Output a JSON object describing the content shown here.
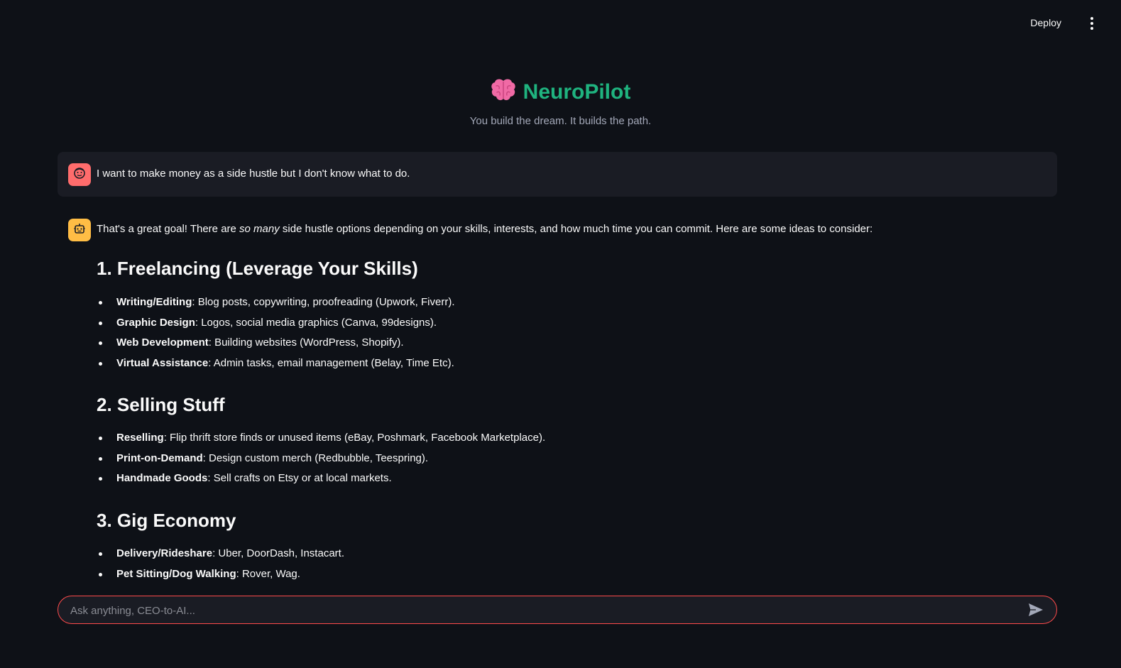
{
  "header": {
    "deploy_label": "Deploy"
  },
  "app": {
    "title": "NeuroPilot",
    "subtitle": "You build the dream. It builds the path.",
    "title_color": "#1fb37f"
  },
  "messages": {
    "user": {
      "text": "I want to make money as a side hustle but I don't know what to do."
    },
    "assistant": {
      "intro_before": "That's a great goal! There are ",
      "intro_em": "so many",
      "intro_after": " side hustle options depending on your skills, interests, and how much time you can commit. Here are some ideas to consider:",
      "sections": [
        {
          "heading": "1. Freelancing (Leverage Your Skills)",
          "items": [
            {
              "bold": "Writing/Editing",
              "text": ": Blog posts, copywriting, proofreading (Upwork, Fiverr)."
            },
            {
              "bold": "Graphic Design",
              "text": ": Logos, social media graphics (Canva, 99designs)."
            },
            {
              "bold": "Web Development",
              "text": ": Building websites (WordPress, Shopify)."
            },
            {
              "bold": "Virtual Assistance",
              "text": ": Admin tasks, email management (Belay, Time Etc)."
            }
          ]
        },
        {
          "heading": "2. Selling Stuff",
          "items": [
            {
              "bold": "Reselling",
              "text": ": Flip thrift store finds or unused items (eBay, Poshmark, Facebook Marketplace)."
            },
            {
              "bold": "Print-on-Demand",
              "text": ": Design custom merch (Redbubble, Teespring)."
            },
            {
              "bold": "Handmade Goods",
              "text": ": Sell crafts on Etsy or at local markets."
            }
          ]
        },
        {
          "heading": "3. Gig Economy",
          "items": [
            {
              "bold": "Delivery/Rideshare",
              "text": ": Uber, DoorDash, Instacart."
            },
            {
              "bold": "Pet Sitting/Dog Walking",
              "text": ": Rover, Wag."
            }
          ]
        }
      ]
    }
  },
  "chat_input": {
    "placeholder": "Ask anything, CEO-to-AI..."
  },
  "icons": {
    "title": "brain-icon",
    "user_avatar": "user-face-icon",
    "assistant_avatar": "robot-icon",
    "send": "send-icon",
    "menu": "kebab-menu-icon"
  },
  "colors": {
    "background": "#0e1117",
    "user_avatar": "#ff6c6c",
    "assistant_avatar": "#ffbd45",
    "input_border": "#ff4b4b"
  }
}
